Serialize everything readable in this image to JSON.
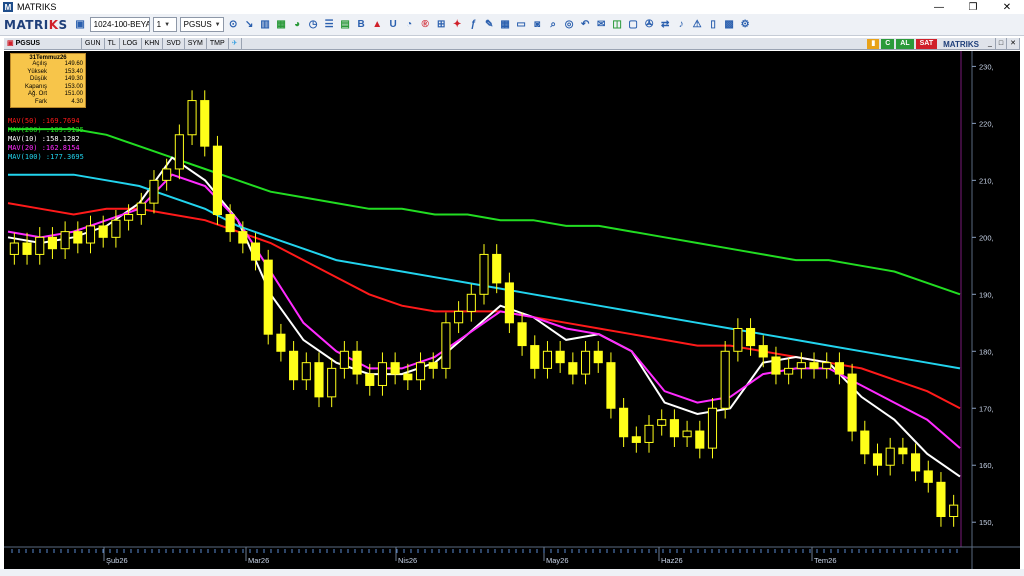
{
  "window": {
    "title": "MATRIKS",
    "minimize": "—",
    "restore": "❐",
    "close": "✕"
  },
  "toolbar": {
    "logo_main": "MATRI",
    "logo_k": "K",
    "logo_end": "S",
    "template_select": "1024-100-BEYA",
    "layout_select": "1",
    "symbol_select": "PGSUS"
  },
  "chartbar": {
    "symbol": "PGSUS",
    "tabs": [
      "GUN",
      "TL",
      "LOG",
      "KHN",
      "SVD",
      "SYM",
      "TMP"
    ],
    "buy": "AL",
    "sell": "SAT",
    "brand": "MATRIKS"
  },
  "info_box": {
    "date": "31Temmuz26",
    "rows": [
      {
        "label": "Açılış",
        "value": "149.60"
      },
      {
        "label": "Yüksek",
        "value": "153.40"
      },
      {
        "label": "Düşük",
        "value": "149.30"
      },
      {
        "label": "Kapanış",
        "value": "153.00"
      },
      {
        "label": "Ağ. Ort",
        "value": "151.00"
      },
      {
        "label": "Fark",
        "value": "4.30"
      }
    ]
  },
  "chart_data": {
    "type": "line",
    "title": "",
    "ylim": [
      146,
      232
    ],
    "y_ticks": [
      "230,",
      "220,",
      "210,",
      "200,",
      "190,",
      "180,",
      "170,",
      "160,",
      "150,"
    ],
    "x_month_labels": [
      "Şub26",
      "Mar26",
      "Nis26",
      "May26",
      "Haz26",
      "Tem26"
    ],
    "candles_close": [
      199,
      197,
      200,
      198,
      201,
      199,
      202,
      200,
      203,
      204,
      206,
      210,
      212,
      218,
      224,
      216,
      204,
      201,
      199,
      196,
      183,
      180,
      175,
      178,
      172,
      177,
      180,
      176,
      174,
      178,
      176,
      175,
      178,
      177,
      185,
      187,
      190,
      197,
      192,
      185,
      181,
      177,
      180,
      178,
      176,
      180,
      178,
      170,
      165,
      164,
      167,
      168,
      165,
      166,
      163,
      170,
      180,
      184,
      181,
      179,
      176,
      177,
      178,
      177,
      178,
      176,
      166,
      162,
      160,
      163,
      162,
      159,
      157,
      151,
      153
    ],
    "series": [
      {
        "name": "MAV(50)",
        "color": "#ff1a1a",
        "values": [
          206,
          205,
          204,
          205,
          205,
          204,
          203,
          201,
          199,
          196,
          193,
          190,
          188,
          187,
          187,
          187,
          186,
          185,
          184,
          183,
          182,
          181,
          181,
          180,
          179,
          178,
          177,
          175,
          173,
          170
        ]
      },
      {
        "name": "MAV(200)",
        "color": "#22dd22",
        "values": [
          219,
          219,
          219,
          218,
          216,
          214,
          212,
          210,
          208,
          207,
          206,
          205,
          205,
          204,
          204,
          203,
          203,
          202,
          202,
          201,
          200,
          199,
          198,
          197,
          196,
          196,
          195,
          194,
          192,
          190
        ]
      },
      {
        "name": "MAV(10)",
        "color": "#ffffff",
        "values": [
          200,
          199,
          200,
          202,
          206,
          214,
          210,
          203,
          190,
          182,
          178,
          176,
          176,
          178,
          183,
          188,
          186,
          182,
          183,
          180,
          171,
          169,
          170,
          178,
          179,
          178,
          172,
          168,
          162,
          158
        ]
      },
      {
        "name": "MAV(20)",
        "color": "#ff2bff",
        "values": [
          201,
          200,
          201,
          203,
          205,
          211,
          209,
          203,
          194,
          185,
          180,
          177,
          177,
          179,
          183,
          187,
          186,
          184,
          183,
          180,
          173,
          171,
          172,
          176,
          177,
          177,
          174,
          171,
          168,
          163
        ]
      },
      {
        "name": "MAV(100)",
        "color": "#22d4ee",
        "values": [
          211,
          211,
          211,
          210,
          209,
          207,
          205,
          202,
          200,
          198,
          196,
          195,
          194,
          193,
          192,
          191,
          190,
          189,
          188,
          187,
          186,
          185,
          184,
          183,
          182,
          181,
          180,
          179,
          178,
          177
        ]
      }
    ],
    "mav_labels": [
      {
        "text": "MAV(50)    :169.7694",
        "color": "#ff1a1a"
      },
      {
        "text": "MAV(200)   :189.9135",
        "color": "#22dd22"
      },
      {
        "text": "MAV(10)    :158.1282",
        "color": "#ffffff"
      },
      {
        "text": "MAV(20)    :162.8154",
        "color": "#ff2bff"
      },
      {
        "text": "MAV(100)   :177.3695",
        "color": "#22d4ee"
      }
    ],
    "candle_color": "#ffff1a",
    "background": "#000000"
  }
}
